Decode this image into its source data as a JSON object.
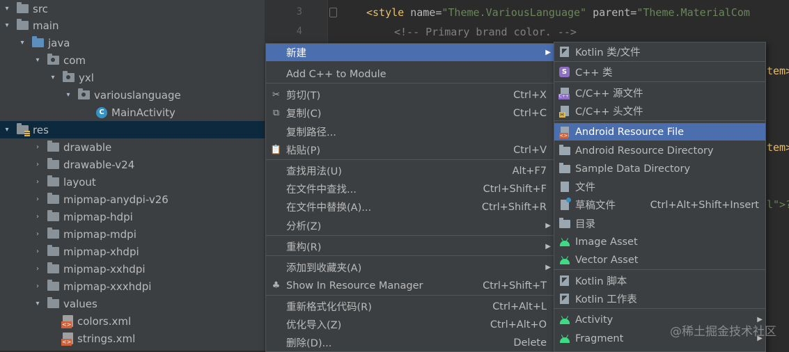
{
  "tree": {
    "items": [
      {
        "label": "src",
        "arrow": "▾",
        "kind": "folder"
      },
      {
        "label": "main",
        "arrow": "▾",
        "kind": "folder"
      },
      {
        "label": "java",
        "arrow": "▾",
        "kind": "folder-blue"
      },
      {
        "label": "com",
        "arrow": "▾",
        "kind": "package"
      },
      {
        "label": "yxl",
        "arrow": "▾",
        "kind": "package"
      },
      {
        "label": "variouslanguage",
        "arrow": "▾",
        "kind": "package"
      },
      {
        "label": "MainActivity",
        "arrow": "",
        "kind": "class",
        "class_letter": "C"
      },
      {
        "label": "res",
        "arrow": "▾",
        "kind": "res-folder",
        "selected": true
      },
      {
        "label": "drawable",
        "arrow": "›",
        "kind": "folder"
      },
      {
        "label": "drawable-v24",
        "arrow": "›",
        "kind": "folder"
      },
      {
        "label": "layout",
        "arrow": "›",
        "kind": "folder"
      },
      {
        "label": "mipmap-anydpi-v26",
        "arrow": "›",
        "kind": "folder"
      },
      {
        "label": "mipmap-hdpi",
        "arrow": "›",
        "kind": "folder"
      },
      {
        "label": "mipmap-mdpi",
        "arrow": "›",
        "kind": "folder"
      },
      {
        "label": "mipmap-xhdpi",
        "arrow": "›",
        "kind": "folder"
      },
      {
        "label": "mipmap-xxhdpi",
        "arrow": "›",
        "kind": "folder"
      },
      {
        "label": "mipmap-xxxhdpi",
        "arrow": "›",
        "kind": "folder"
      },
      {
        "label": "values",
        "arrow": "▾",
        "kind": "folder"
      },
      {
        "label": "colors.xml",
        "arrow": "",
        "kind": "xml"
      },
      {
        "label": "strings.xml",
        "arrow": "",
        "kind": "xml"
      }
    ]
  },
  "editor": {
    "line_numbers": [
      "3",
      "4"
    ],
    "line3": {
      "open": "<style",
      "attr1": " name=",
      "val1": "\"Theme.VariousLanguage\"",
      "attr2": " parent=",
      "val2": "\"Theme.MaterialCom"
    },
    "line4": "<!-- Primary brand color. -->",
    "frag_item1": "tem>",
    "frag_item2": "tem>",
    "frag_l": "l\">?"
  },
  "menu1": {
    "items": [
      {
        "label": "新建",
        "shortcut": "",
        "submenu": true,
        "active": true
      },
      {
        "label": "Add C++ to Module",
        "shortcut": "",
        "submenu": false,
        "sep_after": true
      },
      {
        "label": "剪切(T)",
        "shortcut": "Ctrl+X",
        "icon": "scissors-icon",
        "glyph": "✂"
      },
      {
        "label": "复制(C)",
        "shortcut": "Ctrl+C",
        "icon": "copy-icon",
        "glyph": "⧉"
      },
      {
        "label": "复制路径...",
        "shortcut": ""
      },
      {
        "label": "粘贴(P)",
        "shortcut": "Ctrl+V",
        "icon": "paste-icon",
        "glyph": "📋",
        "sep_after": true
      },
      {
        "label": "查找用法(U)",
        "shortcut": "Alt+F7"
      },
      {
        "label": "在文件中查找...",
        "shortcut": "Ctrl+Shift+F"
      },
      {
        "label": "在文件中替换(A)...",
        "shortcut": "Ctrl+Shift+R"
      },
      {
        "label": "分析(Z)",
        "shortcut": "",
        "submenu": true,
        "sep_after": true
      },
      {
        "label": "重构(R)",
        "shortcut": "",
        "submenu": true,
        "sep_after": true
      },
      {
        "label": "添加到收藏夹(A)",
        "shortcut": "",
        "submenu": true
      },
      {
        "label": "Show In Resource Manager",
        "shortcut": "Ctrl+Shift+T",
        "icon": "resource-manager-icon",
        "glyph": "♣",
        "sep_after": true
      },
      {
        "label": "重新格式化代码(R)",
        "shortcut": "Ctrl+Alt+L"
      },
      {
        "label": "优化导入(Z)",
        "shortcut": "Ctrl+Alt+O"
      },
      {
        "label": "删除(D)...",
        "shortcut": "Delete"
      }
    ]
  },
  "menu2": {
    "items": [
      {
        "label": "Kotlin 类/文件",
        "shortcut": "",
        "icon": "kotlin-file-icon",
        "icon_kind": "kotlin",
        "sep_after": true
      },
      {
        "label": "C++ 类",
        "shortcut": "",
        "icon": "cpp-class-icon",
        "icon_kind": "s",
        "icon_letter": "S",
        "sep_after": true
      },
      {
        "label": "C/C++ 源文件",
        "shortcut": "",
        "icon": "cpp-source-icon",
        "icon_kind": "cpp"
      },
      {
        "label": "C/C++ 头文件",
        "shortcut": "",
        "icon": "cpp-header-icon",
        "icon_kind": "h",
        "sep_after": true
      },
      {
        "label": "Android Resource File",
        "shortcut": "",
        "icon": "resource-file-icon",
        "icon_kind": "res",
        "active": true
      },
      {
        "label": "Android Resource Directory",
        "shortcut": "",
        "icon": "folder-icon",
        "icon_kind": "folder"
      },
      {
        "label": "Sample Data Directory",
        "shortcut": "",
        "icon": "folder-icon",
        "icon_kind": "folder"
      },
      {
        "label": "文件",
        "shortcut": "",
        "icon": "file-icon",
        "icon_kind": "file"
      },
      {
        "label": "草稿文件",
        "shortcut": "Ctrl+Alt+Shift+Insert",
        "icon": "scratch-file-icon",
        "icon_kind": "scratch"
      },
      {
        "label": "目录",
        "shortcut": "",
        "icon": "folder-icon",
        "icon_kind": "folder"
      },
      {
        "label": "Image Asset",
        "shortcut": "",
        "icon": "android-icon",
        "icon_kind": "android"
      },
      {
        "label": "Vector Asset",
        "shortcut": "",
        "icon": "android-icon",
        "icon_kind": "android",
        "sep_after": true
      },
      {
        "label": "Kotlin 脚本",
        "shortcut": "",
        "icon": "kotlin-script-icon",
        "icon_kind": "kotlin"
      },
      {
        "label": "Kotlin 工作表",
        "shortcut": "",
        "icon": "kotlin-worksheet-icon",
        "icon_kind": "kotlin",
        "sep_after": true
      },
      {
        "label": "Activity",
        "shortcut": "",
        "icon": "android-icon",
        "icon_kind": "android",
        "submenu": true
      },
      {
        "label": "Fragment",
        "shortcut": "",
        "icon": "android-icon",
        "icon_kind": "android",
        "submenu": true
      }
    ]
  },
  "watermark": "@稀土掘金技术社区"
}
